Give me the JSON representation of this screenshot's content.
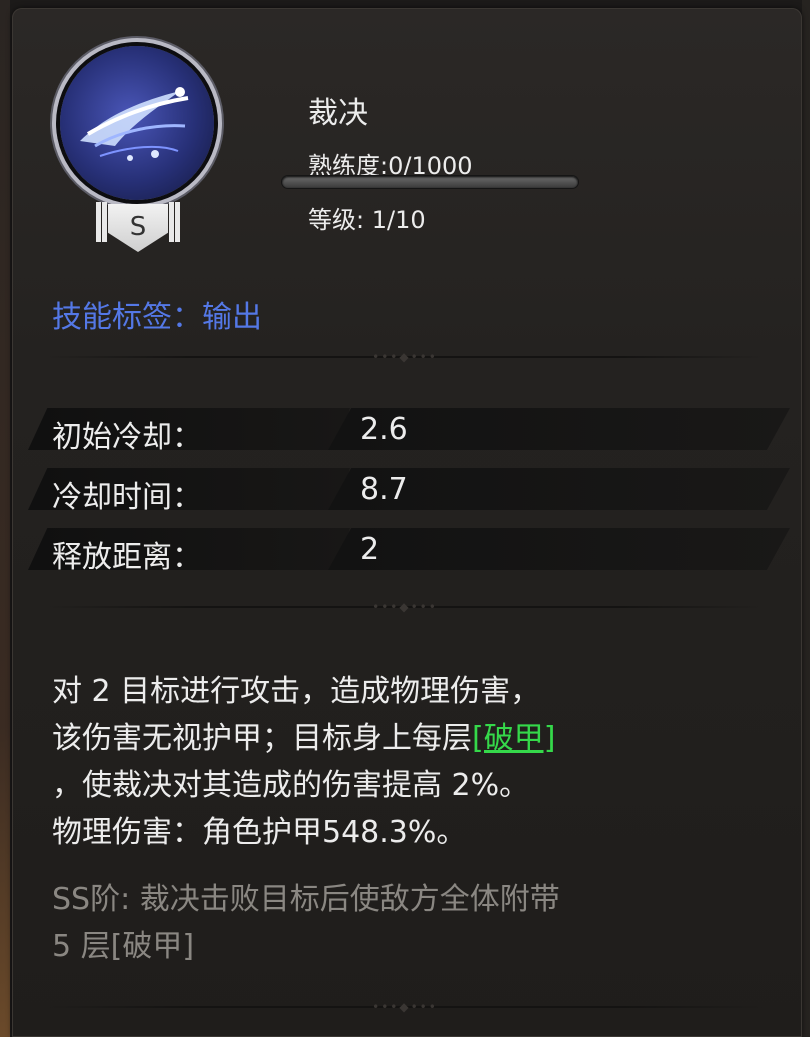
{
  "skill": {
    "name": "裁决",
    "rank": "S",
    "proficiency_text": "熟练度:0/1000",
    "proficiency_fraction": 0.0,
    "level_text": "等级: 1/10",
    "icon": "blue-slash-icon"
  },
  "tags": {
    "label": "技能标签：",
    "value": "输出"
  },
  "stats": [
    {
      "label": "初始冷却：",
      "value": "2.6"
    },
    {
      "label": "冷却时间：",
      "value": "8.7"
    },
    {
      "label": "释放距离：",
      "value": "2"
    }
  ],
  "description": {
    "line1": "对 2 目标进行攻击，造成物理伤害，",
    "line2_pre": "该伤害无视护甲；目标身上每层",
    "line2_link": "[破甲]",
    "line3": "，使裁决对其造成的伤害提高 2%。",
    "line4": "物理伤害：角色护甲548.3%。"
  },
  "ss_note": {
    "line1": "SS阶: 裁决击败目标后使敌方全体附带",
    "line2": "5 层[破甲]"
  },
  "colors": {
    "tag_blue": "#5478e6",
    "link_green": "#35d84a",
    "muted_text": "#8a8782"
  }
}
